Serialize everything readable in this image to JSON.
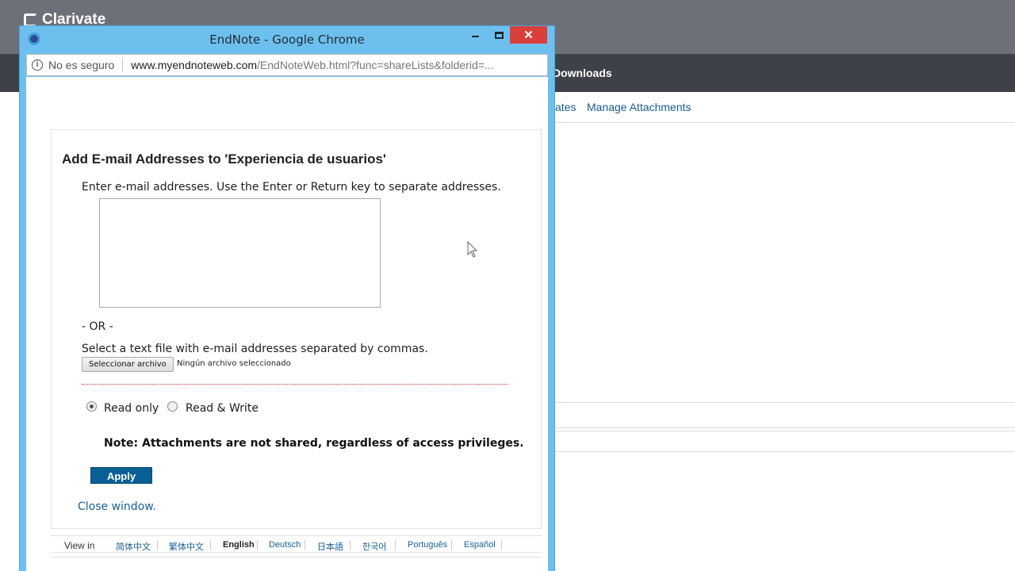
{
  "background": {
    "brand": "Clarivate",
    "nav_item": "Downloads",
    "subnav": [
      "ates",
      "Manage Attachments"
    ]
  },
  "window": {
    "title": "EndNote - Google Chrome",
    "close_glyph": "✕",
    "security_text": "No es seguro",
    "url_host": "www.myendnoteweb.com",
    "url_rest": "/EndNoteWeb.html?func=shareLists&folderid=..."
  },
  "form": {
    "title": "Add E-mail Addresses to 'Experiencia de usuarios'",
    "instructions": "Enter e-mail addresses. Use the Enter or Return key to separate addresses.",
    "emails_value": "",
    "or_text": "- OR -",
    "file_instructions": "Select a text file with e-mail addresses separated by commas.",
    "file_button": "Seleccionar archivo",
    "file_status": "Ningún archivo seleccionado",
    "access": {
      "read_only": "Read only",
      "read_write": "Read & Write",
      "selected": "read_only"
    },
    "note": "Note: Attachments are not shared, regardless of access privileges.",
    "apply": "Apply",
    "close": "Close window."
  },
  "languages": {
    "label": "View in",
    "items": [
      "简体中文",
      "繁体中文",
      "English",
      "Deutsch",
      "日本語",
      "한국어",
      "Português",
      "Español"
    ],
    "active": "English"
  },
  "colors": {
    "accent": "#0a5f97",
    "link": "#1b6093",
    "window_frame": "#6dc0ee",
    "close_button": "#d9403c"
  }
}
